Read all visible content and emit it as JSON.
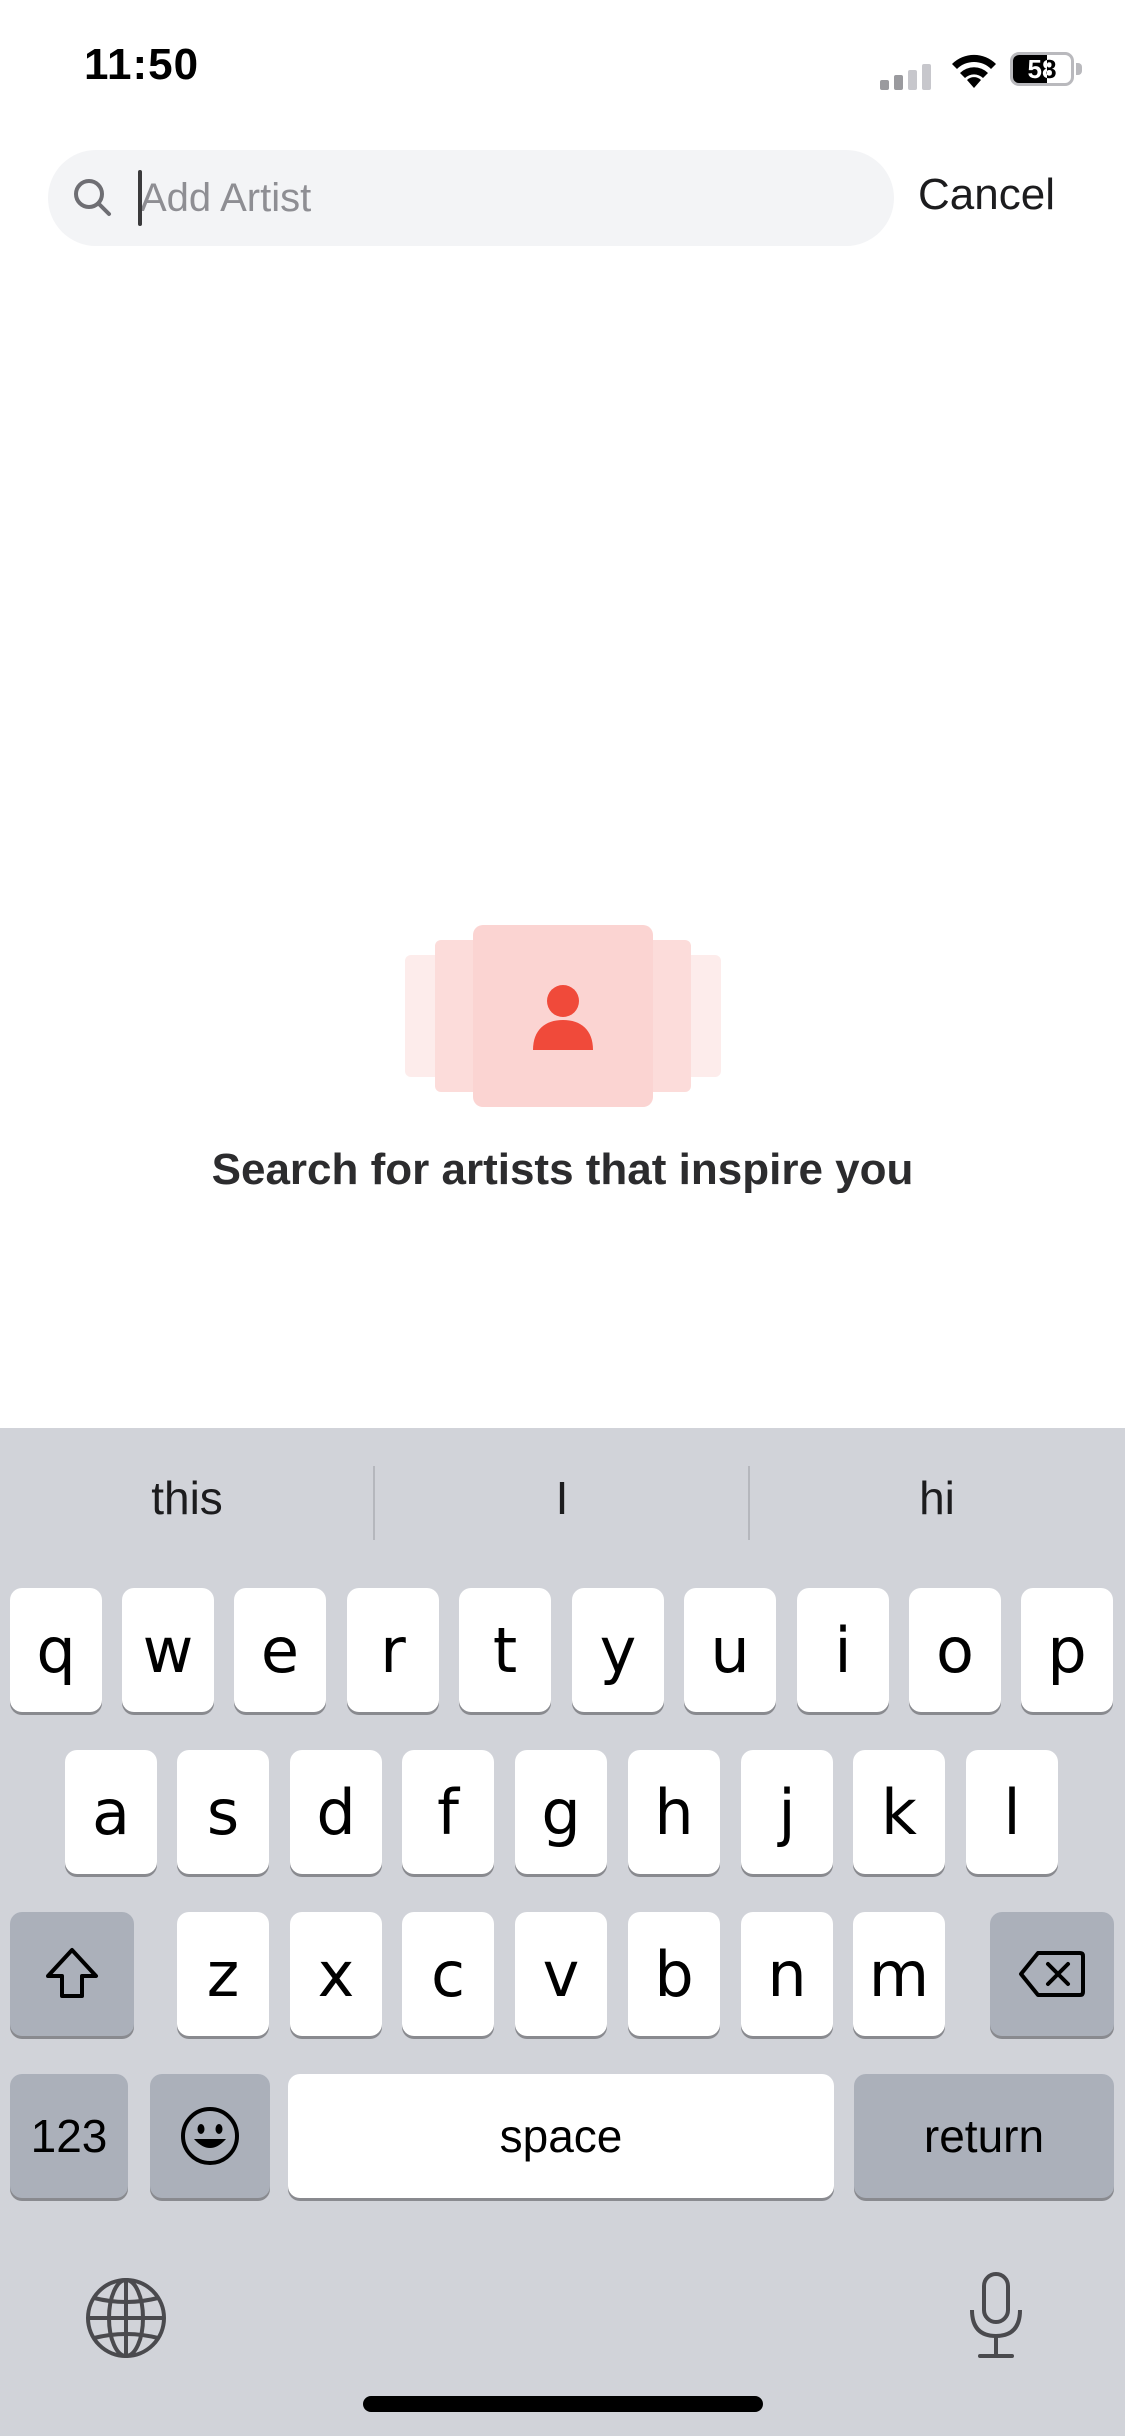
{
  "status_bar": {
    "time": "11:50",
    "battery_level": "58",
    "icons": [
      "signal-icon",
      "wifi-icon",
      "battery-icon"
    ]
  },
  "search": {
    "placeholder": "Add Artist",
    "value": "",
    "cancel_label": "Cancel"
  },
  "empty_state": {
    "message": "Search for artists that inspire you",
    "icon": "person-icon",
    "accent_color": "#f04a3a"
  },
  "keyboard": {
    "suggestions": [
      "this",
      "I",
      "hi"
    ],
    "row1": [
      "q",
      "w",
      "e",
      "r",
      "t",
      "y",
      "u",
      "i",
      "o",
      "p"
    ],
    "row2": [
      "a",
      "s",
      "d",
      "f",
      "g",
      "h",
      "j",
      "k",
      "l"
    ],
    "row3": [
      "z",
      "x",
      "c",
      "v",
      "b",
      "n",
      "m"
    ],
    "numbers_label": "123",
    "space_label": "space",
    "return_label": "return",
    "icons": [
      "shift-icon",
      "delete-icon",
      "emoji-icon",
      "globe-icon",
      "microphone-icon"
    ]
  }
}
